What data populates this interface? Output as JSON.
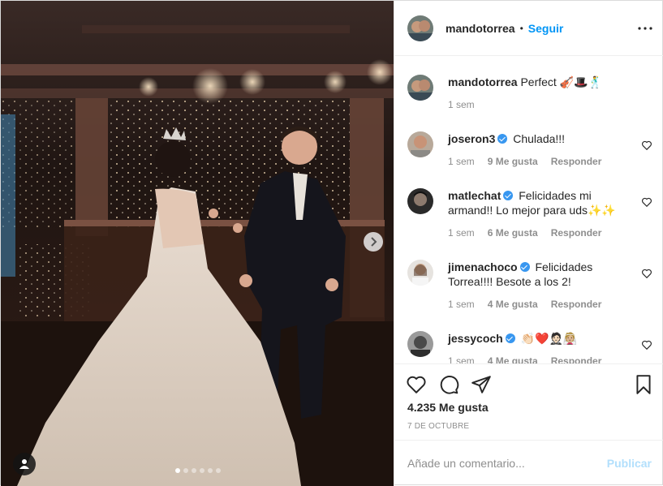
{
  "post": {
    "username": "mandotorrea",
    "separator": "•",
    "follow_label": "Seguir",
    "more_icon": "more-horizontal-icon"
  },
  "caption": {
    "username": "mandotorrea",
    "text": "Perfect 🎻🎩🕺",
    "time": "1 sem"
  },
  "comments": [
    {
      "username": "joseron3",
      "verified": true,
      "text": "Chulada!!!",
      "time": "1 sem",
      "likes": "9 Me gusta",
      "reply": "Responder"
    },
    {
      "username": "matlechat",
      "verified": true,
      "text": "Felicidades mi armand!! Lo mejor para uds✨✨",
      "time": "1 sem",
      "likes": "6 Me gusta",
      "reply": "Responder"
    },
    {
      "username": "jimenachoco",
      "verified": true,
      "text": "Felicidades Torrea!!!! Besote a los 2!",
      "time": "1 sem",
      "likes": "4 Me gusta",
      "reply": "Responder"
    },
    {
      "username": "jessycoch",
      "verified": true,
      "text": "👏🏻❤️🤵🏻👰🏼",
      "time": "1 sem",
      "likes": "4 Me gusta",
      "reply": "Responder"
    }
  ],
  "actions": {
    "likes_count": "4.235 Me gusta",
    "date": "7 DE OCTUBRE"
  },
  "composer": {
    "placeholder": "Añade un comentario...",
    "publish_label": "Publicar"
  },
  "carousel": {
    "slides": 6,
    "active": 1
  },
  "colors": {
    "accent": "#0095f6",
    "publish_disabled": "#b2dffc",
    "muted": "#8e8e8e",
    "verified": "#3897f0"
  }
}
